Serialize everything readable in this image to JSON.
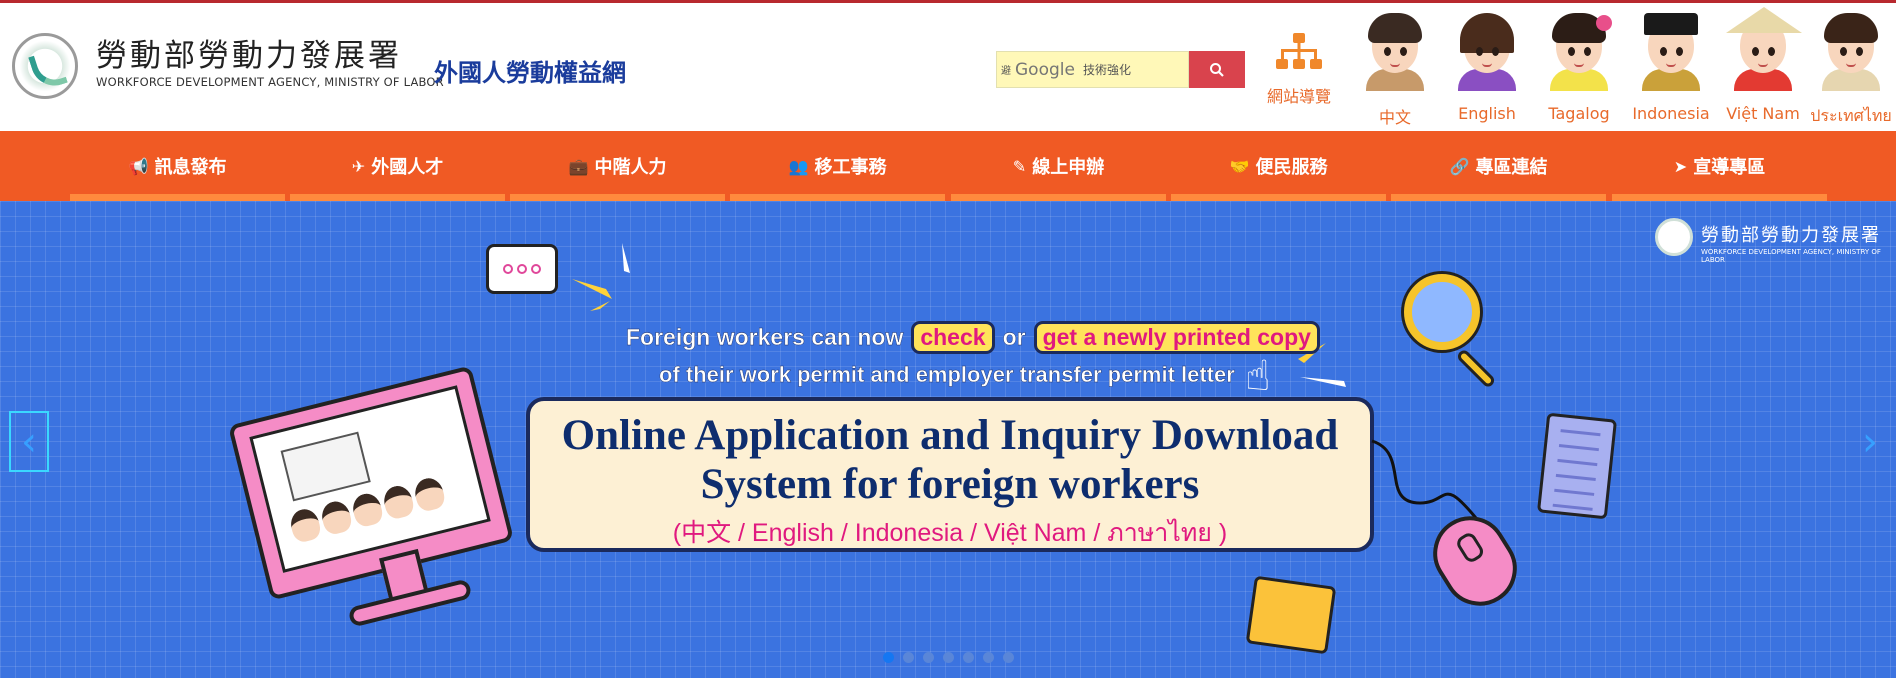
{
  "header": {
    "agency_name_zh": "勞動部勞動力發展署",
    "agency_name_en": "WORKFORCE DEVELOPMENT AGENCY, MINISTRY OF LABOR",
    "site_title": "外國人勞動權益網",
    "search": {
      "prefix": "避",
      "brand": "Google",
      "placeholder": "技術強化"
    },
    "sitemap_label": "網站導覽",
    "languages": [
      {
        "label": "中文"
      },
      {
        "label": "English"
      },
      {
        "label": "Tagalog"
      },
      {
        "label": "Indonesia"
      },
      {
        "label": "Việt Nam"
      },
      {
        "label": "ประเทศไทย"
      }
    ]
  },
  "nav": {
    "items": [
      {
        "label": "訊息發布",
        "icon": "megaphone-icon"
      },
      {
        "label": "外國人才",
        "icon": "plane-icon"
      },
      {
        "label": "中階人力",
        "icon": "briefcase-icon"
      },
      {
        "label": "移工事務",
        "icon": "users-icon"
      },
      {
        "label": "線上申辦",
        "icon": "edit-icon"
      },
      {
        "label": "便民服務",
        "icon": "handshake-icon"
      },
      {
        "label": "專區連結",
        "icon": "link-icon"
      },
      {
        "label": "宣導專區",
        "icon": "send-icon"
      }
    ]
  },
  "banner": {
    "watermark_zh": "勞動部勞動力發展署",
    "watermark_en": "WORKFORCE DEVELOPMENT AGENCY, MINISTRY OF LABOR",
    "line1_prefix": "Foreign workers can now",
    "line1_tag1": "check",
    "line1_or": "or",
    "line1_tag2": "get a newly printed copy",
    "line2": "of their work permit and employer transfer permit letter",
    "title_line1": "Online Application and Inquiry Download",
    "title_line2": "System for foreign workers",
    "languages_line": "(中文 / English / Indonesia / Việt Nam / ภาษาไทย )",
    "slide_count": 7,
    "active_slide": 1
  },
  "colors": {
    "nav_bg": "#f05a24",
    "banner_bg": "#3b73e0",
    "title_blue": "#1a3c9c",
    "lang_orange": "#e86a2b"
  }
}
